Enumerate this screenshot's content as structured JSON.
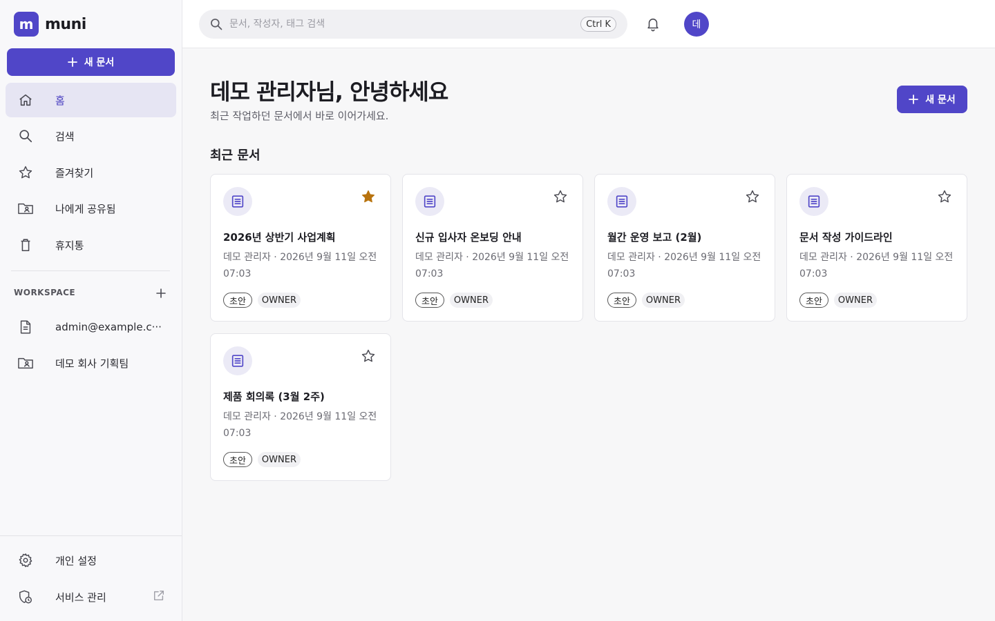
{
  "app": {
    "logo_letter": "m",
    "name": "muni"
  },
  "sidebar": {
    "new_doc_label": "새 문서",
    "nav": [
      {
        "label": "홈",
        "icon": "home-icon",
        "active": true
      },
      {
        "label": "검색",
        "icon": "search-icon"
      },
      {
        "label": "즐겨찾기",
        "icon": "star-icon"
      },
      {
        "label": "나에게 공유됨",
        "icon": "shared-folder-icon"
      },
      {
        "label": "휴지통",
        "icon": "trash-icon"
      }
    ],
    "workspace_title": "WORKSPACE",
    "workspace_items": [
      {
        "label": "admin@example.c···",
        "icon": "document-icon"
      },
      {
        "label": "데모 회사 기획팀",
        "icon": "shared-folder-icon"
      }
    ],
    "bottom": [
      {
        "label": "개인 설정",
        "icon": "gear-icon"
      },
      {
        "label": "서비스 관리",
        "icon": "admin-shield-icon"
      }
    ]
  },
  "topbar": {
    "search_placeholder": "문서, 작성자, 태그 검색",
    "shortcut": "Ctrl K",
    "avatar_initial": "데"
  },
  "main": {
    "greeting": "데모 관리자님, 안녕하세요",
    "subtitle": "최근 작업하던 문서에서 바로 이어가세요.",
    "new_doc_label": "새 문서",
    "section_title": "최근 문서",
    "documents": [
      {
        "title": "2026년 상반기 사업계획",
        "meta": "데모 관리자 · 2026년 9월 11일 오전 07:03",
        "status": "초안",
        "role": "OWNER",
        "starred": true
      },
      {
        "title": "신규 입사자 온보딩 안내",
        "meta": "데모 관리자 · 2026년 9월 11일 오전 07:03",
        "status": "초안",
        "role": "OWNER",
        "starred": false
      },
      {
        "title": "월간 운영 보고 (2월)",
        "meta": "데모 관리자 · 2026년 9월 11일 오전 07:03",
        "status": "초안",
        "role": "OWNER",
        "starred": false
      },
      {
        "title": "문서 작성 가이드라인",
        "meta": "데모 관리자 · 2026년 9월 11일 오전 07:03",
        "status": "초안",
        "role": "OWNER",
        "starred": false
      },
      {
        "title": "제품 회의록 (3월 2주)",
        "meta": "데모 관리자 · 2026년 9월 11일 오전 07:03",
        "status": "초안",
        "role": "OWNER",
        "starred": false
      }
    ]
  },
  "colors": {
    "accent": "#5046c8",
    "star_filled": "#b8730e"
  }
}
